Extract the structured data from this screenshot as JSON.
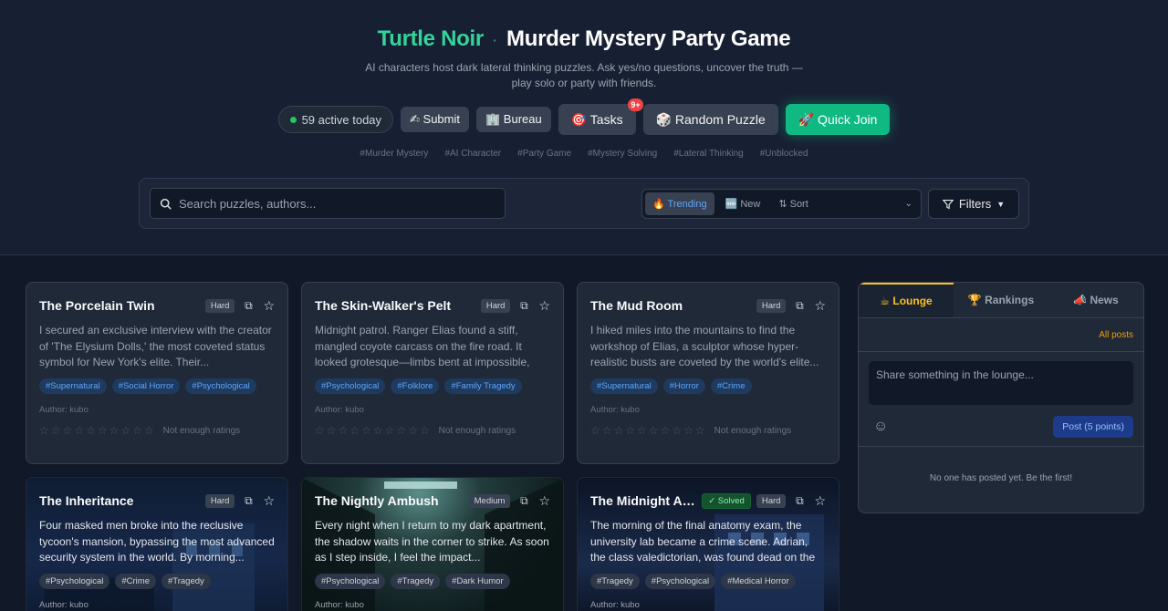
{
  "header": {
    "brand": "Turtle Noir",
    "separator": "·",
    "title": "Murder Mystery Party Game",
    "subtitle": "AI characters host dark lateral thinking puzzles. Ask yes/no questions, uncover the truth — play solo or party with friends."
  },
  "actions": {
    "active_today": "59 active today",
    "submit": "✍ Submit",
    "bureau": "🏢 Bureau",
    "tasks": "🎯 Tasks",
    "tasks_badge": "9+",
    "random": "🎲 Random Puzzle",
    "quick_join": "🚀 Quick Join"
  },
  "hashtags": [
    "#Murder Mystery",
    "#AI Character",
    "#Party Game",
    "#Mystery Solving",
    "#Lateral Thinking",
    "#Unblocked"
  ],
  "search": {
    "placeholder": "Search puzzles, authors...",
    "icon": "search-icon",
    "trending": "🔥 Trending",
    "new": "🆕 New",
    "sort": "⇅ Sort",
    "filters": "Filters"
  },
  "cards": [
    {
      "title": "The Porcelain Twin",
      "difficulty": "Hard",
      "desc": "I secured an exclusive interview with the creator of 'The Elysium Dolls,' the most coveted status symbol for New York's elite. Their...",
      "tags": [
        "#Supernatural",
        "#Social Horror",
        "#Psychological"
      ],
      "author": "Author: kubo",
      "rating_note": "Not enough ratings"
    },
    {
      "title": "The Skin-Walker's Pelt",
      "difficulty": "Hard",
      "desc": "Midnight patrol. Ranger Elias found a stiff, mangled coyote carcass on the fire road. It looked grotesque—limbs bent at impossible, human-like...",
      "tags": [
        "#Psychological",
        "#Folklore",
        "#Family Tragedy"
      ],
      "author": "Author: kubo",
      "rating_note": "Not enough ratings"
    },
    {
      "title": "The Mud Room",
      "difficulty": "Hard",
      "desc": "I hiked miles into the mountains to find the workshop of Elias, a sculptor whose hyper-realistic busts are coveted by the world's elite...",
      "tags": [
        "#Supernatural",
        "#Horror",
        "#Crime"
      ],
      "author": "Author: kubo",
      "rating_note": "Not enough ratings"
    },
    {
      "title": "The Inheritance",
      "difficulty": "Hard",
      "desc": "Four masked men broke into the reclusive tycoon's mansion, bypassing the most advanced security system in the world. By morning...",
      "tags": [
        "#Psychological",
        "#Crime",
        "#Tragedy"
      ],
      "author": "Author: kubo"
    },
    {
      "title": "The Nightly Ambush",
      "difficulty": "Medium",
      "desc": "Every night when I return to my dark apartment, the shadow waits in the corner to strike. As soon as I step inside, I feel the impact...",
      "tags": [
        "#Psychological",
        "#Tragedy",
        "#Dark Humor"
      ],
      "author": "Author: kubo"
    },
    {
      "title": "The Midnight Anatomy Exam",
      "solved": "✓ Solved",
      "difficulty": "Hard",
      "desc": "The morning of the final anatomy exam, the university lab became a crime scene. Adrian, the class valedictorian, was found dead on the floor...",
      "tags": [
        "#Tragedy",
        "#Psychological",
        "#Medical Horror"
      ],
      "author": "Author: kubo"
    }
  ],
  "lounge": {
    "tabs": [
      "☕ Lounge",
      "🏆 Rankings",
      "📣 News"
    ],
    "all_posts": "All posts",
    "placeholder": "Share something in the lounge...",
    "post_button": "Post (5 points)",
    "empty": "No one has posted yet. Be the first!"
  }
}
